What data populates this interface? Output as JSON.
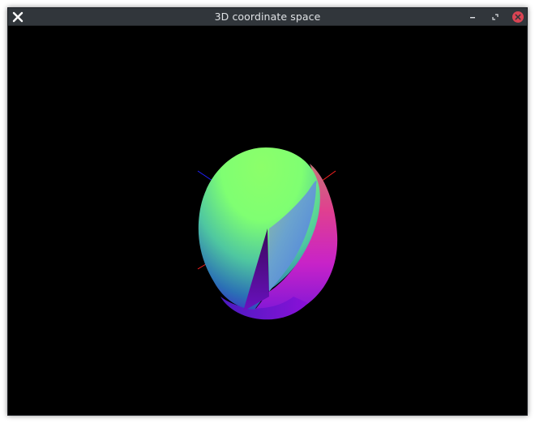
{
  "window": {
    "title": "3D coordinate space",
    "controls": {
      "minimize_icon": "minimize-icon",
      "maximize_icon": "restore-icon",
      "close_icon": "close-icon"
    }
  },
  "viewport": {
    "background": "#000000",
    "object": "egg-shaped 3D surface with normal-map coloring",
    "axis_colors": {
      "x": "#ff2020",
      "z": "#2020ff"
    }
  },
  "colors": {
    "titlebar": "#31363b",
    "close_button": "#da4453"
  }
}
